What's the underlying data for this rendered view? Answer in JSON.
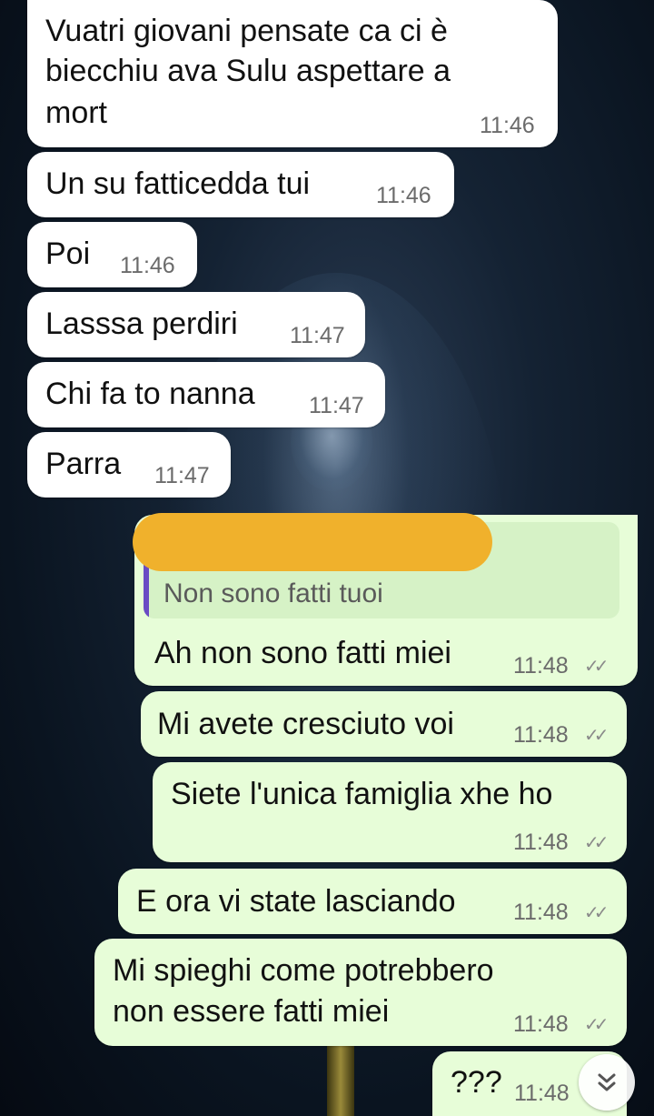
{
  "messages": [
    {
      "direction": "in",
      "lines": [
        "Vuatri giovani pensate ca ci è",
        "biecchiu ava Sulu aspettare a",
        "mort"
      ],
      "time": "11:46"
    },
    {
      "direction": "in",
      "lines": [
        "Un su fatticedda tui"
      ],
      "time": "11:46"
    },
    {
      "direction": "in",
      "lines": [
        "Poi"
      ],
      "time": "11:46"
    },
    {
      "direction": "in",
      "lines": [
        "Lasssa perdiri"
      ],
      "time": "11:47"
    },
    {
      "direction": "in",
      "lines": [
        "Chi fa to nanna"
      ],
      "time": "11:47"
    },
    {
      "direction": "in",
      "lines": [
        "Parra"
      ],
      "time": "11:47"
    },
    {
      "direction": "out",
      "reply_quote": "Non sono fatti tuoi",
      "lines": [
        "Ah non sono fatti miei"
      ],
      "time": "11:48",
      "status": "read"
    },
    {
      "direction": "out",
      "lines": [
        "Mi avete cresciuto voi"
      ],
      "time": "11:48",
      "status": "read"
    },
    {
      "direction": "out",
      "lines": [
        "Siete l'unica famiglia xhe ho"
      ],
      "time": "11:48",
      "status": "read"
    },
    {
      "direction": "out",
      "lines": [
        "E ora vi state lasciando"
      ],
      "time": "11:48",
      "status": "read"
    },
    {
      "direction": "out",
      "lines": [
        "Mi spieghi come potrebbero",
        "non essere fatti miei"
      ],
      "time": "11:48",
      "status": "read"
    },
    {
      "direction": "out",
      "lines": [
        "???"
      ],
      "time": "11:48",
      "status": "read"
    }
  ],
  "icons": {
    "read_ticks": "double-check-icon",
    "scroll_down": "double-chevron-down-icon"
  },
  "colors": {
    "incoming_bubble": "#ffffff",
    "outgoing_bubble": "#e7fdd8",
    "reply_bar": "#6a4bc4",
    "redaction": "#f0b12c"
  }
}
